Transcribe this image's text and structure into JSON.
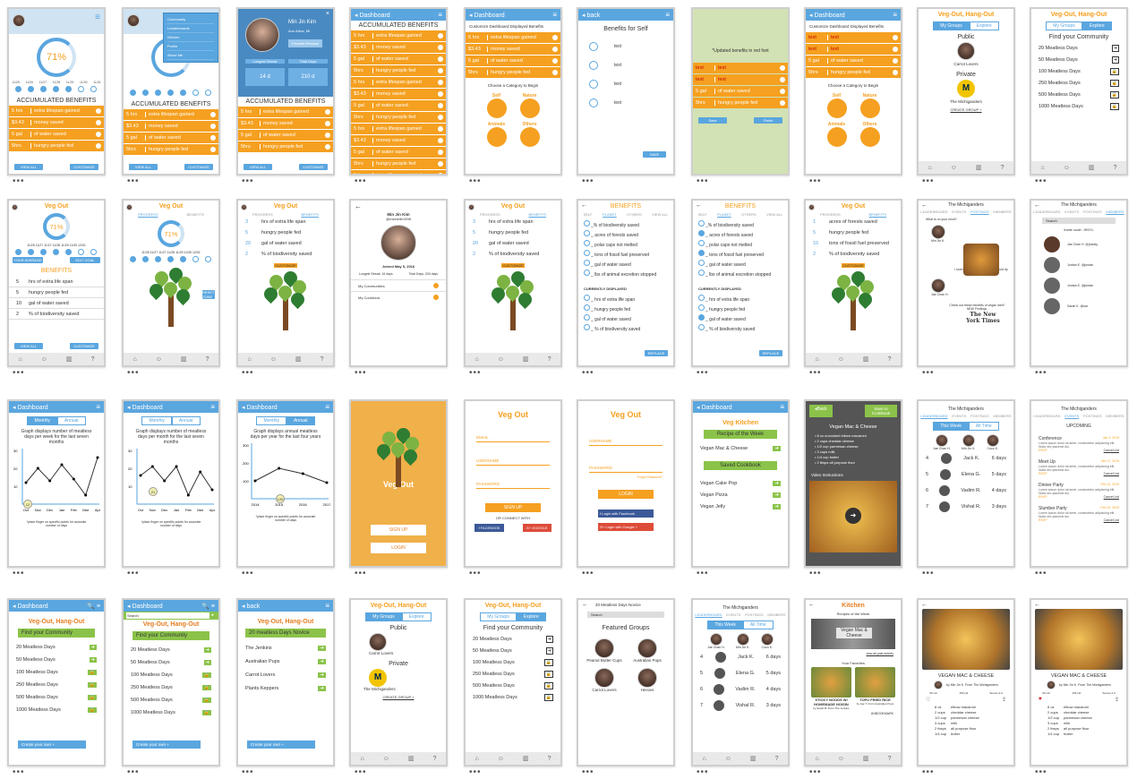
{
  "common": {
    "accumulated_title": "ACCUMULATED BENEFITS",
    "dashboard": "Dashboard",
    "back": "back",
    "veg_out": "Veg Out",
    "veg_out_hang": "Veg-Out, Hang-Out",
    "customize": "CUSTOMIZE",
    "benefits_upper": "BENEFITS",
    "progress": "PROGRESS",
    "benefits_tab": "BENEFITS",
    "create_group": "CREATE GROUP +",
    "find_community": "Find your Community",
    "create_own": "Create your own +",
    "michiganders": "The Michiganders",
    "leaderboard": "LEADERBOARD",
    "events": "EVENTS",
    "postings": "POSTINGS",
    "members": "MEMBERS",
    "this_week": "This Week",
    "all_time": "All Time",
    "my_groups": "My Groups",
    "explore": "Explore",
    "public": "Public",
    "private": "Private",
    "carrot_lovers": "Carrot Lovers",
    "the_michiganders": "The Michiganders"
  },
  "benefit_rows": [
    {
      "amt": "5 hrs",
      "label": "extra lifespan gained"
    },
    {
      "amt": "$3.43",
      "label": "money saved"
    },
    {
      "amt": "5 gal",
      "label": "of water saved"
    },
    {
      "amt": "5hrs",
      "label": "hungry people fed"
    }
  ],
  "benefit_rows_long": [
    {
      "amt": "5 hrs",
      "label": "extra lifespan gained"
    },
    {
      "amt": "$3.43",
      "label": "money saved"
    },
    {
      "amt": "5 gal",
      "label": "of water saved"
    },
    {
      "amt": "5hrs",
      "label": "hungry people fed"
    },
    {
      "amt": "5 hrs",
      "label": "extra lifespan gained"
    },
    {
      "amt": "$3.43",
      "label": "money saved"
    },
    {
      "amt": "5 gal",
      "label": "of water saved"
    },
    {
      "amt": "5hrs",
      "label": "hungry people fed"
    },
    {
      "amt": "5 hrs",
      "label": "extra lifespan gained"
    },
    {
      "amt": "$3.43",
      "label": "money saved"
    },
    {
      "amt": "5 gal",
      "label": "of water saved"
    },
    {
      "amt": "5hrs",
      "label": "hungry people fed"
    },
    {
      "amt": "5 hrs",
      "label": "extra lifespan gained"
    }
  ],
  "red_rows": [
    {
      "amt": "text",
      "label": "text"
    },
    {
      "amt": "text",
      "label": "text"
    },
    {
      "amt": "5 gal",
      "label": "of water saved"
    },
    {
      "amt": "5hrs",
      "label": "hungry people fed"
    }
  ],
  "meatless": [
    "20 Meatless Days",
    "50 Meatless Days",
    "100 Meatless Days",
    "250 Meatless Days",
    "500 Meatless Days",
    "1000 Meatless Days"
  ],
  "stats": [
    {
      "num": "5",
      "label": "hrs of extra life span"
    },
    {
      "num": "5",
      "label": "hungry people fed"
    },
    {
      "num": "10",
      "label": "gal of water saved"
    },
    {
      "num": "2",
      "label": "% of biodiversity saved"
    }
  ],
  "stats_alt": [
    {
      "num": "3",
      "label": "hrs of extra life span"
    },
    {
      "num": "5",
      "label": "hungry people fed"
    },
    {
      "num": "20",
      "label": "gal of water saved"
    },
    {
      "num": "2",
      "label": "% of biodiversity saved"
    }
  ],
  "leaders": [
    {
      "rank": "4",
      "name": "Jack K.",
      "days": "6 days"
    },
    {
      "rank": "5",
      "name": "Elena G.",
      "days": "5 days"
    },
    {
      "rank": "6",
      "name": "Vadim R.",
      "days": "4 days"
    },
    {
      "rank": "7",
      "name": "Vishal R.",
      "days": "3 days"
    }
  ],
  "podium": [
    "Jae Chan H.",
    "Min Jin K.",
    "Coco K."
  ],
  "screens": {
    "s1": {
      "percent": "71%",
      "title": "ACCUMULATED BENEFITS",
      "days": [
        "11/25",
        "11/26",
        "11/27",
        "11/28",
        "11/29",
        "11/30",
        "11/31"
      ]
    },
    "s2": {
      "menu": [
        "Community",
        "Leaderboards",
        "Kitchen",
        "Profile",
        "About Me"
      ]
    },
    "s3": {
      "name": "Min Jin Kim",
      "location": "Ann Arbor, MI",
      "fav": "Favorite Recipes",
      "longest": "Longest Streak",
      "total": "Total Days",
      "longest_val": "14 d",
      "total_val": "210 d"
    },
    "s6": {
      "title": "Customize Dashboard Displayed Benefits",
      "choose": "Choose a Category to Begin",
      "cats": [
        "Self",
        "Nature",
        "Animals",
        "Others"
      ]
    },
    "s7": {
      "title": "Benefits for Self",
      "items": [
        "text",
        "text",
        "text",
        "text"
      ],
      "save": "SAVE"
    },
    "s8": {
      "note": "*Updated benefits in red font"
    },
    "r2": {
      "dates": "11/25 11/27 11/27 11/28 11/29 11/30 12/01",
      "your_average": "YOUR AVERAGE",
      "edit_goal": "EDIT GOAL",
      "view_all": "VIEW ALL",
      "reset_zone": "RESET ZONE"
    },
    "profile": {
      "name": "Min Jin Kim",
      "handle": "@michelle1998",
      "joined": "Joined May 5, 2016",
      "longest": "Longest Streak: 16 days",
      "total": "Total Days: 200 days",
      "my_communities": "My Communities",
      "my_cookbook": "My Cookbook"
    },
    "planet": {
      "tabs": [
        "SELF",
        "PLANET",
        "OTHERS",
        "VIEW ALL"
      ],
      "items": [
        "_% of biodiversity saved",
        "_ acres of forests saved",
        "_ polar caps not melted",
        "_ tons of fossil fuel preserved",
        "_ gal of water saved",
        "_ lbs of animal excretion stopped"
      ],
      "currently": "CURRENTLY DISPLAYED",
      "current": [
        "_ hrs of extra life span",
        "_ hungry people fed",
        "_ gal of water saved",
        "_ % of biodiversity saved"
      ],
      "replace": "REPLACE"
    },
    "posts": {
      "prompt": "What is on your mind?",
      "user1": "Min Jin K.",
      "caption1": "I loved this recipe! You guys should try it out",
      "days1": "2 days ago",
      "user2": "Jae Chan H.",
      "caption2": "Check out these benefits of vegan diet!! NEW Findings",
      "days2": "2 days ago",
      "nyt": "The New York Times"
    },
    "members": {
      "search": "Search",
      "invite": "Invite code: J9SYL",
      "people": [
        "Jae Chan H. @jhanky",
        "Jordan E. @jordan",
        "Jordan E. @jordan",
        "Sarah K. @sar"
      ]
    },
    "graphs": [
      {
        "a": "Monthly",
        "b": "Annual",
        "desc": "Graph displays number of meatless days per week for the last seven months",
        "x": [
          "Oct",
          "Nov",
          "Dec",
          "Jan",
          "Feb",
          "Mar",
          "Apr"
        ],
        "hint": "*place finger on specific points for accurate number of days",
        "bubble": "12"
      },
      {
        "a": "Monthly",
        "b": "Annual",
        "desc": "Graph displays number of meatless days per month for the last seven months",
        "x": [
          "Oct",
          "Nov",
          "Dec",
          "Jan",
          "Feb",
          "Mar",
          "Apr"
        ],
        "hint": "*place finger on specific points for accurate number of days",
        "bubble": "21"
      },
      {
        "a": "Monthly",
        "b": "Annual",
        "desc": "Graph displays annual meatless days per year for the last four years",
        "x": [
          "2014",
          "2015",
          "2016",
          "2017"
        ],
        "hint": "*place finger on specific points for accurate number of days",
        "bubble": "120"
      }
    ],
    "splash": {
      "title": "Veg Out",
      "signup": "SIGN UP",
      "login": "LOGIN"
    },
    "signup": {
      "title": "Veg Out",
      "email": "EMAIL",
      "username": "USERNAME",
      "password": "PASSWORD",
      "btn": "SIGN UP",
      "connect": "OR CONNECT WITH",
      "facebook": "FACEBOOK",
      "google": "GOOGLE"
    },
    "login": {
      "title": "Veg Out",
      "username": "USERNAME",
      "password": "PASSWORD",
      "forgot": "Forgot Password?",
      "btn": "LOGIN",
      "fb": "Login with Facebook",
      "gg": "Login with Google +"
    },
    "kitchen": {
      "title": "Veg Kitchen",
      "week": "Recipe of the Week",
      "mac": "Vegan Mac & Cheese",
      "saved": "Saved Cookbook",
      "items": [
        "Vegan Cake Pop",
        "Vegan Pizza",
        "Vegan Jelly"
      ]
    },
    "recipe_dark": {
      "back": "Back",
      "save": "Save to Cookbook",
      "title": "Vegan Mac & Cheese",
      "ingredients": [
        "8 oz uncooked elbow macaroni",
        "2 cups cheddar cheese",
        "1/2 cup parmesan cheese",
        "3 cups milk",
        "1/4 cup butter",
        "2 tbsps all purpose flour"
      ],
      "video": "Video Instructions"
    },
    "events": {
      "upcoming": "UPCOMING",
      "items": [
        {
          "t": "Conference",
          "d": "Jan 3, 2019"
        },
        {
          "t": "Meet Up",
          "d": "Jan 17, 2019"
        },
        {
          "t": "Dinner Party",
          "d": "Feb 14, 2019"
        },
        {
          "t": "Slumber Party",
          "d": "Feb 24, 2019"
        }
      ],
      "lorem": "Lorem ipsum dolor sit amet, consectetur adipiscing elit. Nulla nec placerat dui.",
      "cancel": "Cancel List",
      "rsvp": "RSVP"
    },
    "novice": {
      "title": "20 meatless Days Novice",
      "groups": [
        "The Jenkins",
        "Australian Pups",
        "Carrot Lovers",
        "Plants Keppers"
      ],
      "create": "Create your own +"
    },
    "featured": {
      "title": "20 Meatless Days Novice",
      "search": "Search",
      "heading": "Featured Groups",
      "groups": [
        "Peanut Butter Cups",
        "Australian Pups",
        "Carrot Lovers",
        "Heroes"
      ]
    },
    "kitchen2": {
      "title": "Kitchen",
      "week": "Recipes of the Week",
      "feature": "Vegan Mac & Cheese",
      "view_all": "view all past entries",
      "favorites": "Your Favorites",
      "fav1": "STICKY NOODS W/ HOMEMADE HOISIN",
      "fav2": "TOFU FRIED RICE",
      "by1": "by Sarah B. From The Jenkins",
      "by2": "by Jae T. From Australian Pups",
      "unbookmark": "UNBOOKMARK"
    },
    "recipe": {
      "title": "VEGAN MAC & CHEESE",
      "by": "by Min Jin K. From The Michiganders",
      "ing": [
        [
          "8 oz",
          "elbow macaroni"
        ],
        [
          "2 cups",
          "cheddar cheese"
        ],
        [
          "1/2 cup",
          "parmesan cheese"
        ],
        [
          "3 cups",
          "milk"
        ],
        [
          "2 tbsps",
          "all purpose flour"
        ],
        [
          "1/4 cup",
          "butter"
        ]
      ],
      "meta": [
        "30 min",
        "159 cal",
        "Serves 2-3"
      ]
    }
  }
}
